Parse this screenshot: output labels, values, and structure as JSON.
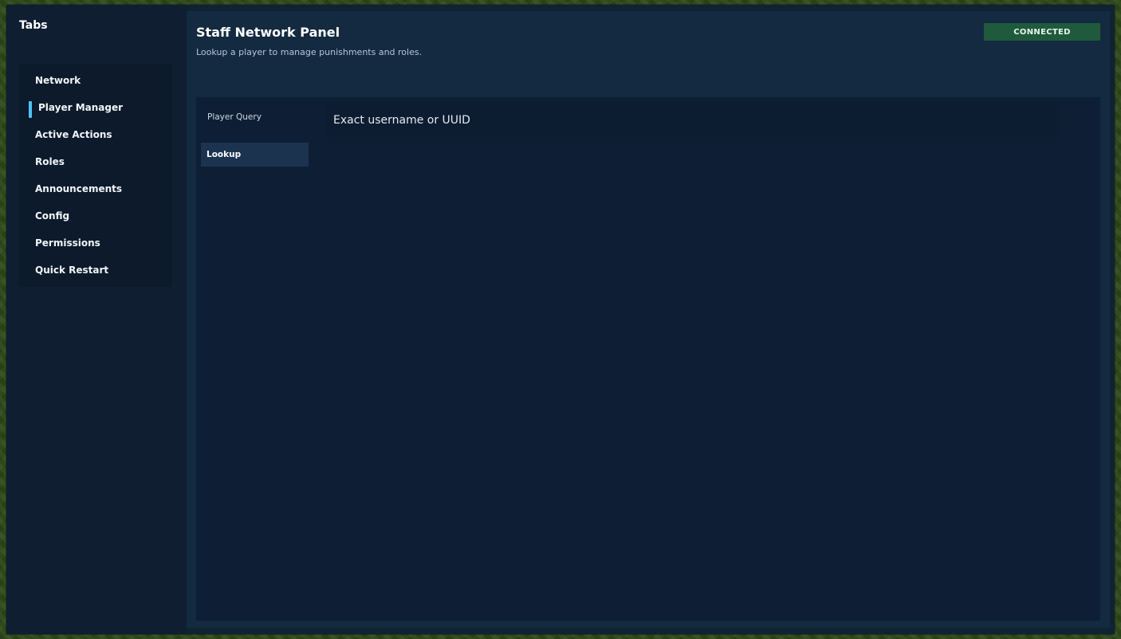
{
  "sidebar": {
    "title": "Tabs",
    "items": [
      {
        "label": "Network",
        "active": false
      },
      {
        "label": "Player Manager",
        "active": true
      },
      {
        "label": "Active Actions",
        "active": false
      },
      {
        "label": "Roles",
        "active": false
      },
      {
        "label": "Announcements",
        "active": false
      },
      {
        "label": "Config",
        "active": false
      },
      {
        "label": "Permissions",
        "active": false
      },
      {
        "label": "Quick Restart",
        "active": false
      }
    ],
    "indicator_color": "#4fc3f7"
  },
  "header": {
    "title": "Staff Network Panel",
    "subtitle": "Lookup a player to manage punishments and roles.",
    "status": "CONNECTED",
    "status_color": "#1f5a3c"
  },
  "player_query": {
    "section_label": "Player Query",
    "nav_items": [
      {
        "label": "Lookup",
        "active": true
      }
    ],
    "search": {
      "value": "",
      "placeholder": "Exact username or UUID"
    }
  }
}
